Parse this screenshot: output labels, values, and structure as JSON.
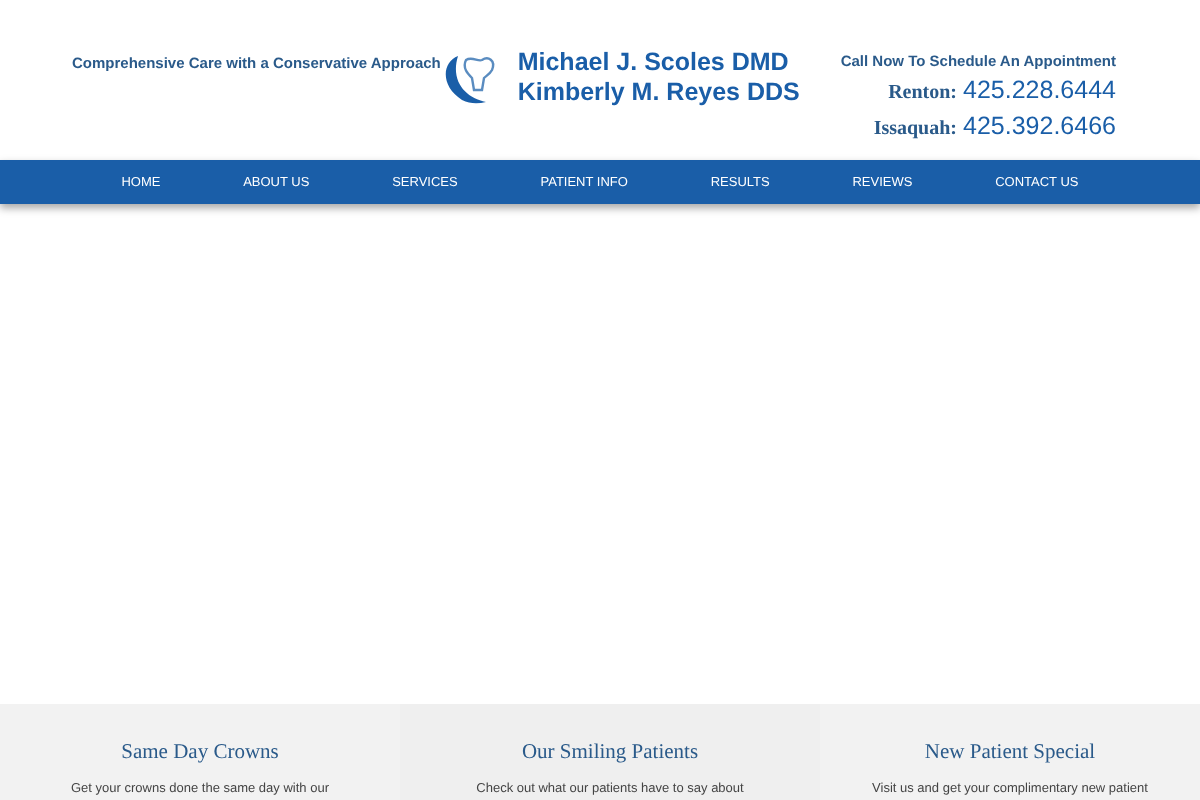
{
  "header": {
    "tagline": "Comprehensive Care with a Conservative Approach",
    "logo_lines": [
      "Michael J. Scoles DMD",
      "Kimberly M. Reyes DDS"
    ],
    "call_label": "Call Now To Schedule An Appointment",
    "phones": [
      {
        "location": "Renton:",
        "number": "425.228.6444"
      },
      {
        "location": "Issaquah:",
        "number": "425.392.6466"
      }
    ]
  },
  "nav": [
    "HOME",
    "ABOUT US",
    "SERVICES",
    "PATIENT INFO",
    "RESULTS",
    "REVIEWS",
    "CONTACT US"
  ],
  "features": [
    {
      "title": "Same Day Crowns",
      "text": "Get your crowns done the same day with our"
    },
    {
      "title": "Our Smiling Patients",
      "text": "Check out what our patients have to say about"
    },
    {
      "title": "New Patient Special",
      "text": "Visit us and get your complimentary new patient"
    }
  ]
}
